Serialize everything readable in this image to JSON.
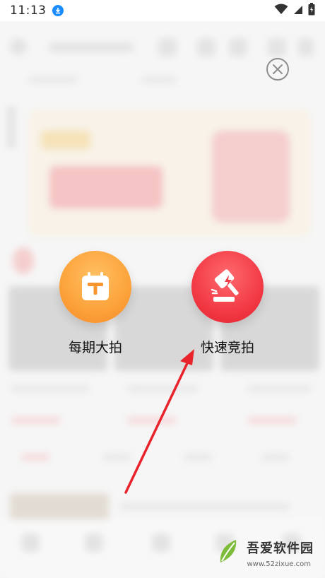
{
  "status_bar": {
    "time": "11:13",
    "icons": [
      "download-icon",
      "wifi-icon",
      "signal-icon",
      "battery-icon"
    ]
  },
  "actions": [
    {
      "label": "每期大拍",
      "icon": "calendar-gavel-icon",
      "color": "#fca23a"
    },
    {
      "label": "快速竞拍",
      "icon": "lightning-gavel-icon",
      "color": "#f23a45"
    }
  ],
  "close_icon": "close-icon",
  "watermark": {
    "title": "吾爱软件园",
    "url": "www.52zixue.com"
  },
  "colors": {
    "accent_red": "#f23a45",
    "accent_orange": "#fca23a",
    "arrow": "#e8232b"
  }
}
